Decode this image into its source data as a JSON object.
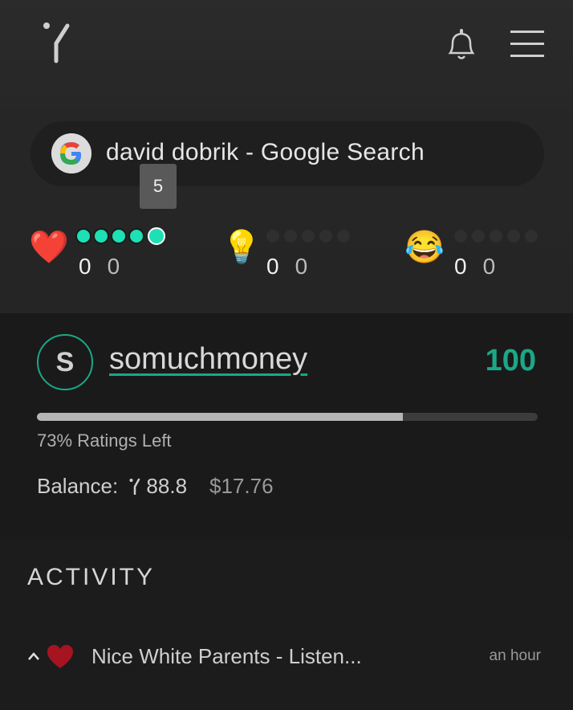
{
  "header": {
    "logo": "logo-icon",
    "notifications": "bell-icon",
    "menu": "menu-icon"
  },
  "search": {
    "text": "david dobrik - Google Search",
    "icon": "google-icon"
  },
  "tooltip": {
    "value": "5"
  },
  "ratings": [
    {
      "emoji": "❤️",
      "icon": "heart-icon",
      "level": 5,
      "count1": "0",
      "count2": "0"
    },
    {
      "emoji": "💡",
      "icon": "lightbulb-icon",
      "level": 0,
      "count1": "0",
      "count2": "0"
    },
    {
      "emoji": "😂",
      "icon": "laughing-icon",
      "level": 0,
      "count1": "0",
      "count2": "0"
    }
  ],
  "user": {
    "initial": "S",
    "username": "somuchmoney",
    "score": "100",
    "ratings_left_fraction": 0.73,
    "ratings_left_text": "73% Ratings Left",
    "balance_label": "Balance:",
    "balance_tokens": "88.8",
    "balance_usd": "$17.76"
  },
  "activity": {
    "title": "ACTIVITY",
    "items": [
      {
        "text": "Nice White Parents - Listen...",
        "time": "an hour",
        "icon": "heart-icon"
      }
    ]
  },
  "colors": {
    "accent": "#1aa886",
    "dot_active": "#1de0b5"
  }
}
